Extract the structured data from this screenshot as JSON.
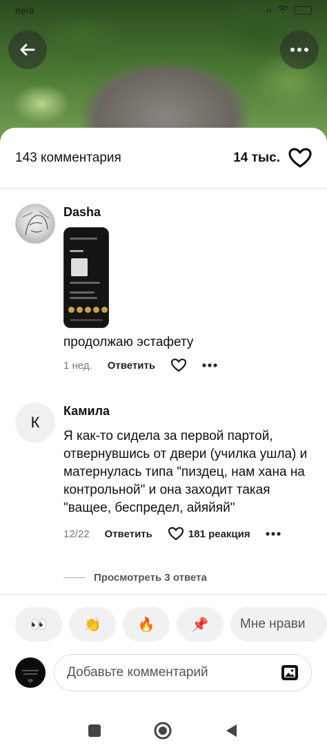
{
  "status_bar": {
    "left_text": "ne!ə",
    "signal": "..ıl"
  },
  "header": {
    "comment_count": "143 комментария",
    "likes_count": "14 тыс."
  },
  "comments": [
    {
      "author": "Dasha",
      "text": "продолжаю эстафету",
      "time": "1 нед.",
      "reply_label": "Ответить",
      "has_image": true
    },
    {
      "author": "Камила",
      "avatar_letter": "К",
      "text": "Я как-то сидела за первой партой, отвернувшись от двери (училка ушла) и матернулась типа \"пиздец, нам хана на контрольной\" и она заходит такая \"ващее, беспредел, айяйяй\"",
      "time": "12/22",
      "reply_label": "Ответить",
      "reactions": "181 реакция",
      "view_replies": "Просмотреть 3 ответа"
    }
  ],
  "reaction_chips": [
    "👀",
    "👏",
    "🔥",
    "📌"
  ],
  "reaction_text_chip": "Мне нрави",
  "composer": {
    "placeholder": "Добавьте комментарий"
  },
  "colors": {
    "text": "#111111",
    "muted": "#777777",
    "chip_bg": "#f1f1f1",
    "border": "#e4e4e4"
  }
}
